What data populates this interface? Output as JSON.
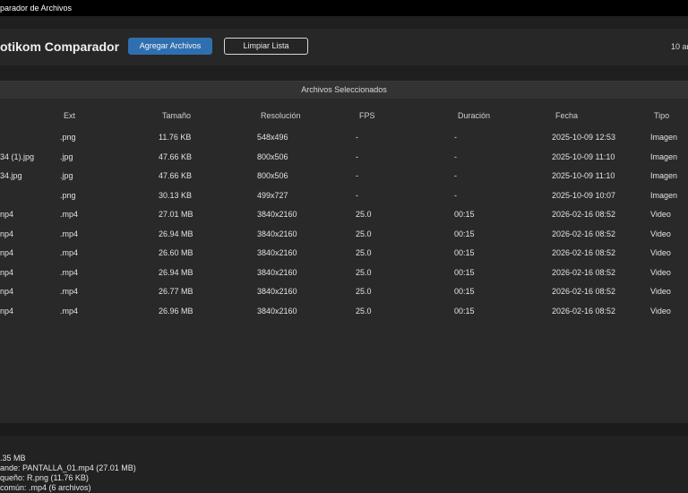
{
  "window": {
    "title": "parador de Archivos"
  },
  "header": {
    "app_title": "otikom Comparador",
    "add_button": "Agregar Archivos",
    "clear_button": "Limpiar Lista",
    "file_count": "10 ar"
  },
  "table": {
    "title": "Archivos Seleccionados",
    "columns": [
      "Ext",
      "Tamaño",
      "Resolución",
      "FPS",
      "Duración",
      "Fecha",
      "Tipo"
    ],
    "rows": [
      {
        "name": "",
        "ext": ".png",
        "size": "11.76 KB",
        "res": "548x496",
        "fps": "-",
        "dur": "-",
        "date": "2025-10-09 12:53",
        "type": "Imagen"
      },
      {
        "name": "34 (1).jpg",
        "ext": ".jpg",
        "size": "47.66 KB",
        "res": "800x506",
        "fps": "-",
        "dur": "-",
        "date": "2025-10-09 11:10",
        "type": "Imagen"
      },
      {
        "name": "34.jpg",
        "ext": ".jpg",
        "size": "47.66 KB",
        "res": "800x506",
        "fps": "-",
        "dur": "-",
        "date": "2025-10-09 11:10",
        "type": "Imagen"
      },
      {
        "name": "",
        "ext": ".png",
        "size": "30.13 KB",
        "res": "499x727",
        "fps": "-",
        "dur": "-",
        "date": "2025-10-09 10:07",
        "type": "Imagen"
      },
      {
        "name": "np4",
        "ext": ".mp4",
        "size": "27.01 MB",
        "res": "3840x2160",
        "fps": "25.0",
        "dur": "00:15",
        "date": "2026-02-16 08:52",
        "type": "Video"
      },
      {
        "name": "np4",
        "ext": ".mp4",
        "size": "26.94 MB",
        "res": "3840x2160",
        "fps": "25.0",
        "dur": "00:15",
        "date": "2026-02-16 08:52",
        "type": "Video"
      },
      {
        "name": "np4",
        "ext": ".mp4",
        "size": "26.60 MB",
        "res": "3840x2160",
        "fps": "25.0",
        "dur": "00:15",
        "date": "2026-02-16 08:52",
        "type": "Video"
      },
      {
        "name": "np4",
        "ext": ".mp4",
        "size": "26.94 MB",
        "res": "3840x2160",
        "fps": "25.0",
        "dur": "00:15",
        "date": "2026-02-16 08:52",
        "type": "Video"
      },
      {
        "name": "np4",
        "ext": ".mp4",
        "size": "26.77 MB",
        "res": "3840x2160",
        "fps": "25.0",
        "dur": "00:15",
        "date": "2026-02-16 08:52",
        "type": "Video"
      },
      {
        "name": "np4",
        "ext": ".mp4",
        "size": "26.96 MB",
        "res": "3840x2160",
        "fps": "25.0",
        "dur": "00:15",
        "date": "2026-02-16 08:52",
        "type": "Video"
      }
    ]
  },
  "stats": {
    "total": ".35 MB",
    "largest": "ande: PANTALLA_01.mp4 (27.01 MB)",
    "smallest": "queño: R.png (11.76 KB)",
    "common": "común: .mp4 (6 archivos)"
  },
  "colors": {
    "accent": "#2f6fb0",
    "background": "#1f1f1f",
    "panel": "#292929",
    "titlebar": "#000000"
  }
}
